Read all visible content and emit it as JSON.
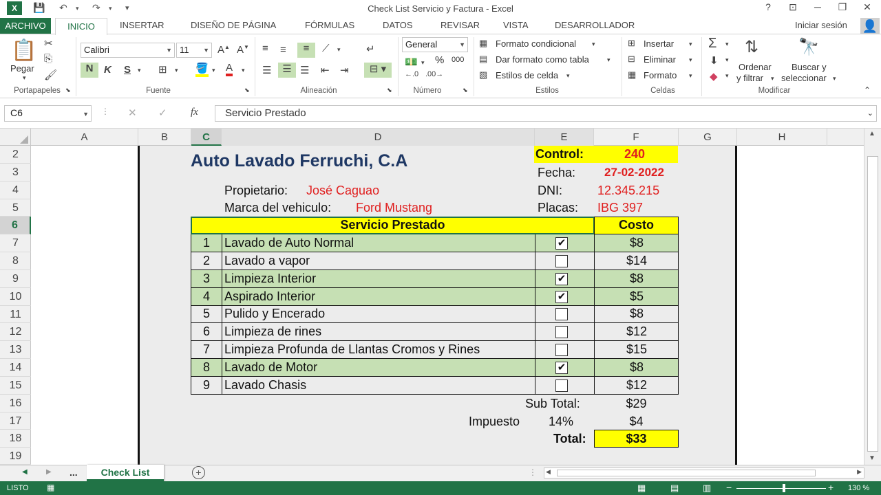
{
  "titlebar": {
    "title": "Check List Servicio y Factura - Excel",
    "help": "?",
    "minimize": "─",
    "restore": "❐",
    "close": "✕"
  },
  "tabs": [
    "ARCHIVO",
    "INICIO",
    "INSERTAR",
    "DISEÑO DE PÁGINA",
    "FÓRMULAS",
    "DATOS",
    "REVISAR",
    "VISTA",
    "DESARROLLADOR"
  ],
  "signin": "Iniciar sesión",
  "ribbon": {
    "clipboard": {
      "paste": "Pegar",
      "label": "Portapapeles"
    },
    "font": {
      "name": "Calibri",
      "size": "11",
      "bold": "N",
      "italic": "K",
      "underline": "S",
      "label": "Fuente"
    },
    "alignment": {
      "label": "Alineación"
    },
    "number": {
      "format": "General",
      "percent": "%",
      "thousands": "000",
      "label": "Número"
    },
    "styles": {
      "conditional": "Formato condicional",
      "as_table": "Dar formato como tabla",
      "cell_styles": "Estilos de celda",
      "label": "Estilos"
    },
    "cells": {
      "insert": "Insertar",
      "delete": "Eliminar",
      "format": "Formato",
      "label": "Celdas"
    },
    "editing": {
      "sort_line1": "Ordenar",
      "sort_line2": "y filtrar",
      "find_line1": "Buscar y",
      "find_line2": "seleccionar",
      "label": "Modificar"
    }
  },
  "formula_bar": {
    "name_box": "C6",
    "fx": "fx",
    "content": "Servicio Prestado"
  },
  "columns": [
    "A",
    "B",
    "C",
    "D",
    "E",
    "F",
    "G",
    "H"
  ],
  "rows": [
    "2",
    "3",
    "4",
    "5",
    "6",
    "7",
    "8",
    "9",
    "10",
    "11",
    "12",
    "13",
    "14",
    "15",
    "16",
    "17",
    "18",
    "19"
  ],
  "invoice": {
    "company": "Auto Lavado Ferruchi, C.A",
    "control_label": "Control:",
    "control_value": "240",
    "date_label": "Fecha:",
    "date_value": "27-02-2022",
    "dni_label": "DNI:",
    "dni_value": "12.345.215",
    "plates_label": "Placas:",
    "plates_value": "IBG 397",
    "owner_label": "Propietario:",
    "owner_value": "José Caguao",
    "brand_label": "Marca del vehiculo:",
    "brand_value": "Ford Mustang",
    "service_header": "Servicio Prestado",
    "cost_header": "Costo",
    "services": [
      {
        "n": "1",
        "name": "Lavado de Auto Normal",
        "checked": true,
        "cost": "$8"
      },
      {
        "n": "2",
        "name": "Lavado a vapor",
        "checked": false,
        "cost": "$14"
      },
      {
        "n": "3",
        "name": "Limpieza Interior",
        "checked": true,
        "cost": "$8"
      },
      {
        "n": "4",
        "name": "Aspirado Interior",
        "checked": true,
        "cost": "$5"
      },
      {
        "n": "5",
        "name": "Pulido y Encerado",
        "checked": false,
        "cost": "$8"
      },
      {
        "n": "6",
        "name": "Limpieza de rines",
        "checked": false,
        "cost": "$12"
      },
      {
        "n": "7",
        "name": "Limpieza Profunda de Llantas Cromos y Rines",
        "checked": false,
        "cost": "$15"
      },
      {
        "n": "8",
        "name": "Lavado de Motor",
        "checked": true,
        "cost": "$8"
      },
      {
        "n": "9",
        "name": "Lavado Chasis",
        "checked": false,
        "cost": "$12"
      }
    ],
    "subtotal_label": "Sub Total:",
    "subtotal_value": "$29",
    "tax_label": "Impuesto",
    "tax_rate": "14%",
    "tax_value": "$4",
    "total_label": "Total:",
    "total_value": "$33"
  },
  "sheet_tabs": {
    "ellipsis": "...",
    "active": "Check List",
    "add": "+"
  },
  "status": {
    "ready": "LISTO",
    "zoom": "130 %"
  },
  "colors": {
    "excel_green": "#217346",
    "row_green": "#c6e0b4",
    "highlight_yellow": "#ffff00",
    "value_red": "#e02020"
  }
}
